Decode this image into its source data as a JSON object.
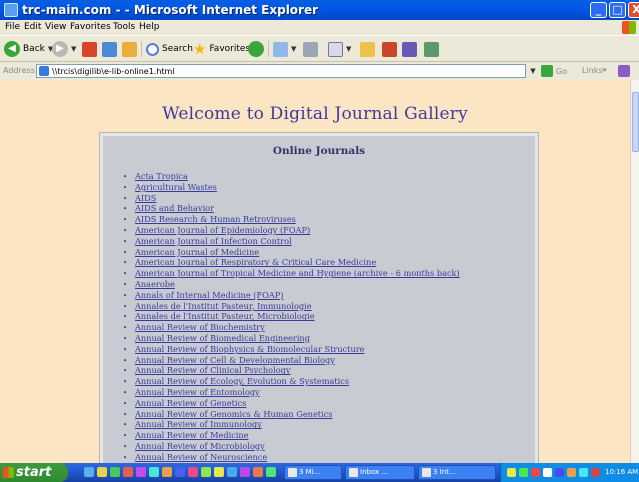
{
  "window": {
    "title": "trc-main.com - - Microsoft Internet Explorer",
    "controls": {
      "minimize": "_",
      "maximize": "□",
      "close": "X"
    }
  },
  "menu": [
    "File",
    "Edit",
    "View",
    "Favorites",
    "Tools",
    "Help"
  ],
  "toolbar": {
    "back_label": "Back",
    "search_label": "Search",
    "favorites_label": "Favorites"
  },
  "address": {
    "label": "Address",
    "value": "\\\\trcis\\digilib\\e-lib-online1.html",
    "go_label": "Go",
    "links_label": "Links",
    "links_arrow": "»"
  },
  "page": {
    "title": "Welcome to Digital Journal Gallery",
    "box_heading": "Online Journals",
    "journals": [
      "Acta Tropica",
      "Agricultural Wastes",
      "AIDS",
      "AIDS and Behavior",
      "AIDS Research & Human Retroviruses",
      "American Journal of Epidemiology (FOAP)",
      "American Journal of Infection Control",
      "American Journal of Medicine",
      "American Journal of Respiratory & Critical Care Medicine",
      "American Journal of Tropical Medicine and Hygiene (archive - 6 months back)",
      "Anaerobe",
      "Annals of Internal Medicine (FOAP)",
      "Annales de l'Institut Pasteur, Immunologie",
      "Annales de l'Institut Pasteur, Microbiologie",
      "Annual Review of Biochemistry",
      "Annual Review of Biomedical Engineering",
      "Annual Review of Biophysics & Biomolecular Structure",
      "Annual Review of Cell & Developmental Biology",
      "Annual Review of Clinical Psychology",
      "Annual Review of Ecology, Evolution & Systematics",
      "Annual Review of Entomology",
      "Annual Review of Genetics",
      "Annual Review of Genomics & Human Genetics",
      "Annual Review of Immunology",
      "Annual Review of Medicine",
      "Annual Review of Microbiology",
      "Annual Review of Neuroscience"
    ]
  },
  "taskbar": {
    "start_label": "start",
    "tasks": [
      "3 Mi...",
      "Inbox ...",
      "3 Int..."
    ],
    "clock": "10:16 AM"
  },
  "colors": {
    "page_background": "#fbe5c2",
    "box_background": "#c8cbd2",
    "link": "#3a3a9a",
    "title": "#3a3aa0"
  }
}
